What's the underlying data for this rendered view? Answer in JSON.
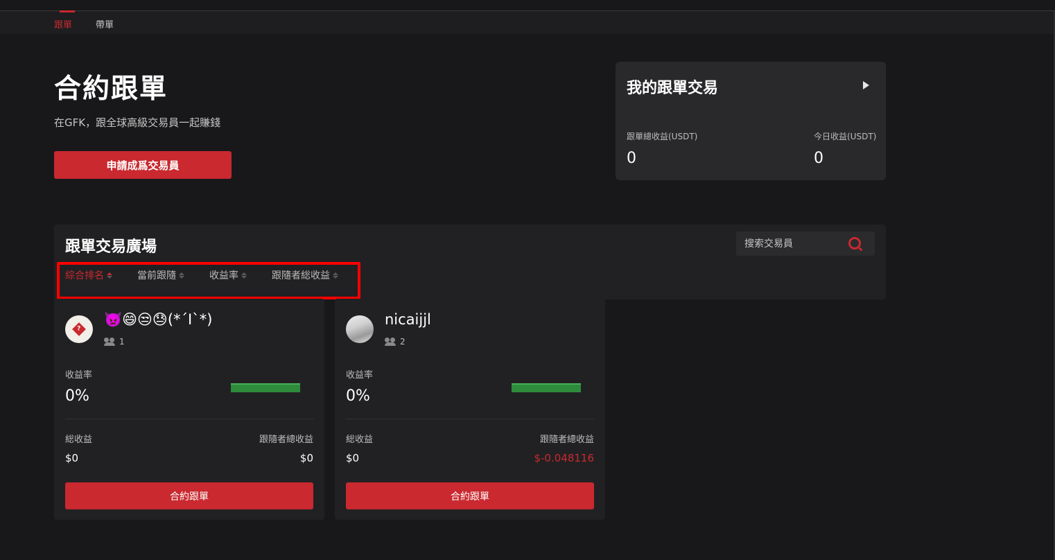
{
  "nav": {
    "tabs": [
      {
        "label": "跟單",
        "active": true
      },
      {
        "label": "帶單",
        "active": false
      }
    ]
  },
  "hero": {
    "title": "合約跟單",
    "subtitle": "在GFK，跟全球高級交易員一起賺錢",
    "apply_button": "申請成爲交易員"
  },
  "my_trades": {
    "title": "我的跟單交易",
    "total_label": "跟單總收益(USDT)",
    "total_value": "0",
    "today_label": "今日收益(USDT)",
    "today_value": "0"
  },
  "square": {
    "title": "跟單交易廣場",
    "search_placeholder": "搜索交易員",
    "sort_options": [
      {
        "label": "綜合排名",
        "active": true
      },
      {
        "label": "當前跟隨",
        "active": false
      },
      {
        "label": "收益率",
        "active": false
      },
      {
        "label": "跟隨者総收益",
        "active": false
      }
    ]
  },
  "traders": [
    {
      "name": "👿😄😒😓(*´I`*)",
      "followers": "1",
      "yield_label": "收益率",
      "yield_value": "0%",
      "total_label": "総收益",
      "total_value": "$0",
      "follower_total_label": "跟隨者總收益",
      "follower_total_value": "$0",
      "follower_total_negative": false,
      "button": "合約跟單"
    },
    {
      "name": "nicaijjl",
      "followers": "2",
      "yield_label": "收益率",
      "yield_value": "0%",
      "total_label": "総收益",
      "total_value": "$0",
      "follower_total_label": "跟隨者總收益",
      "follower_total_value": "$-0.048116",
      "follower_total_negative": true,
      "button": "合約跟單"
    }
  ],
  "colors": {
    "accent": "#c9292f",
    "background": "#18181a",
    "card": "#212123",
    "positive_bar": "#2e8b3c",
    "highlight": "#ff0000"
  }
}
